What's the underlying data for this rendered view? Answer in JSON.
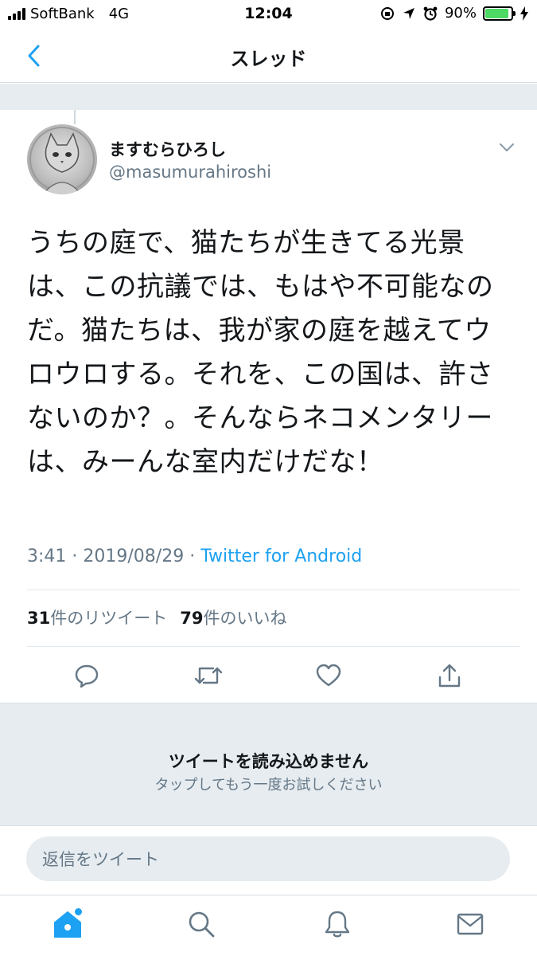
{
  "status_bar": {
    "carrier": "SoftBank",
    "network": "4G",
    "time": "12:04",
    "battery_percent": "90%",
    "battery_level": 0.9,
    "battery_color": "#4cd964"
  },
  "nav": {
    "title": "スレッド",
    "back_icon": "chevron-left-icon"
  },
  "tweet": {
    "display_name": "ますむらひろし",
    "handle": "@masumurahiroshi",
    "text": "うちの庭で、猫たちが生きてる光景は、この抗議では、もはや不可能なのだ。猫たちは、我が家の庭を越えてウロウロする。それを、この国は、許さないのか？。そんならネコメンタリーは、みーんな室内だけだな！",
    "time": "3:41",
    "date": "2019/08/29",
    "separator": "·",
    "source": "Twitter for Android",
    "retweet_count": "31",
    "retweet_label": "件のリツイート",
    "like_count": "79",
    "like_label": "件のいいね"
  },
  "load_error": {
    "title": "ツイートを読み込めません",
    "subtitle": "タップしてもう一度お試しください"
  },
  "reply": {
    "placeholder": "返信をツイート"
  },
  "colors": {
    "accent": "#1da1f2",
    "secondary_text": "#657786",
    "band": "#e6ecf0"
  },
  "tabs": [
    "home-icon",
    "search-icon",
    "bell-icon",
    "mail-icon"
  ]
}
